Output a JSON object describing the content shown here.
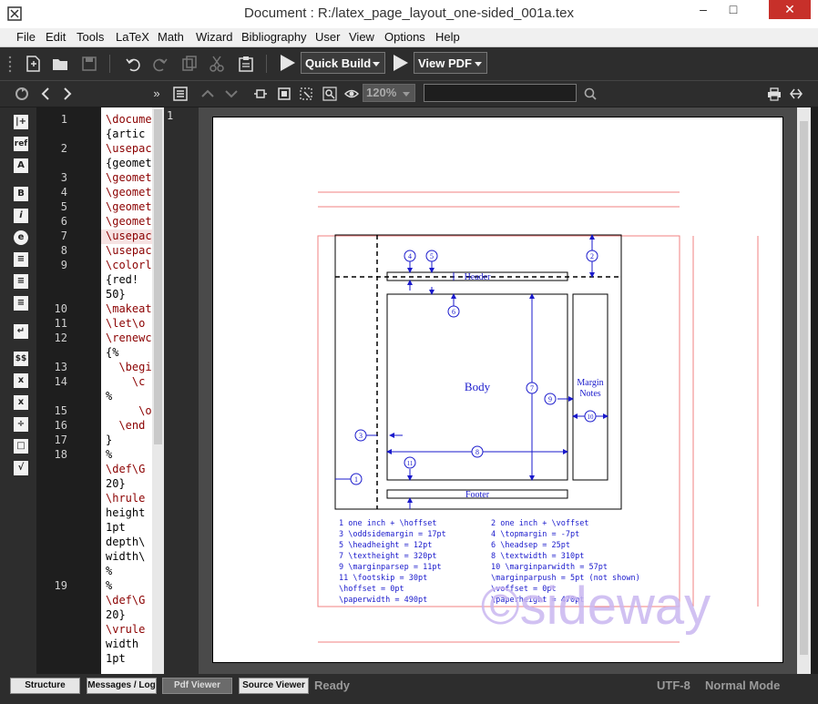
{
  "window": {
    "title": "Document : R:/latex_page_layout_one-sided_001a.tex",
    "minimize": "–",
    "maximize": "□",
    "close": "✕"
  },
  "menu": [
    "File",
    "Edit",
    "Tools",
    "LaTeX",
    "Math",
    "Wizard",
    "Bibliography",
    "User",
    "View",
    "Options",
    "Help"
  ],
  "toolbar": {
    "build_label": "Quick Build",
    "view_label": "View PDF"
  },
  "pdf_toolbar": {
    "zoom": "120%",
    "search_value": ""
  },
  "left_sidebar_icons": [
    "|+",
    "ref",
    "A",
    "B",
    "i",
    "e",
    "≡",
    "≡",
    "≡",
    "↵",
    "$$",
    "x",
    "x",
    "÷",
    "□",
    "√"
  ],
  "editor": {
    "lines": [
      {
        "num": "1",
        "text": "\\docume"
      },
      {
        "num": "",
        "text": "{artic"
      },
      {
        "num": "2",
        "text": "\\usepac"
      },
      {
        "num": "",
        "text": "{geomet"
      },
      {
        "num": "3",
        "text": "\\geomet"
      },
      {
        "num": "4",
        "text": "\\geomet"
      },
      {
        "num": "5",
        "text": "\\geomet"
      },
      {
        "num": "6",
        "text": "\\geomet"
      },
      {
        "num": "7",
        "text": "\\usepac"
      },
      {
        "num": "8",
        "text": "\\usepac"
      },
      {
        "num": "9",
        "text": "\\colorl"
      },
      {
        "num": "",
        "text": "{red!"
      },
      {
        "num": "",
        "text": "50}"
      },
      {
        "num": "10",
        "text": "\\makeat"
      },
      {
        "num": "11",
        "text": "\\let\\o"
      },
      {
        "num": "12",
        "text": "\\renewc"
      },
      {
        "num": "",
        "text": "{%"
      },
      {
        "num": "13",
        "text": "  \\begi"
      },
      {
        "num": "14",
        "text": "    \\c"
      },
      {
        "num": "",
        "text": "%"
      },
      {
        "num": "15",
        "text": "     \\o"
      },
      {
        "num": "16",
        "text": "  \\end"
      },
      {
        "num": "17",
        "text": "}"
      },
      {
        "num": "18",
        "text": "%"
      },
      {
        "num": "",
        "text": "\\def\\G"
      },
      {
        "num": "",
        "text": "20}"
      },
      {
        "num": "",
        "text": "\\hrule"
      },
      {
        "num": "",
        "text": "height"
      },
      {
        "num": "",
        "text": "1pt"
      },
      {
        "num": "",
        "text": "depth\\"
      },
      {
        "num": "",
        "text": "width\\"
      },
      {
        "num": "",
        "text": "%"
      },
      {
        "num": "19",
        "text": "%"
      },
      {
        "num": "",
        "text": "\\def\\G"
      },
      {
        "num": "",
        "text": "20}"
      },
      {
        "num": "",
        "text": "\\vrule"
      },
      {
        "num": "",
        "text": "width"
      },
      {
        "num": "",
        "text": "1pt"
      }
    ]
  },
  "pdf": {
    "page_number": "1",
    "labels": {
      "header": "Header",
      "body": "Body",
      "margin_notes_1": "Margin",
      "margin_notes_2": "Notes",
      "footer": "Footer"
    },
    "callouts": [
      "1",
      "2",
      "3",
      "4",
      "5",
      "6",
      "7",
      "8",
      "9",
      "10",
      "11"
    ],
    "legend_left": [
      "1   one inch + \\hoffset",
      "3   \\oddsidemargin = 17pt",
      "5   \\headheight = 12pt",
      "7   \\textheight = 320pt",
      "9   \\marginparsep = 11pt",
      "11  \\footskip = 30pt",
      "    \\hoffset = 0pt",
      "    \\paperwidth = 490pt"
    ],
    "legend_right": [
      "2   one inch + \\voffset",
      "4   \\topmargin = -7pt",
      "6   \\headsep = 25pt",
      "8   \\textwidth = 310pt",
      "10  \\marginparwidth = 57pt",
      "    \\marginparpush = 5pt (not shown)",
      "    \\voffset = 0pt",
      "    \\paperheight = 470pt"
    ],
    "watermark": "©sideway"
  },
  "statusbar": {
    "buttons": [
      "Structure",
      "Messages / Log",
      "Pdf Viewer",
      "Source Viewer"
    ],
    "status": "Ready",
    "encoding": "UTF-8",
    "mode": "Normal Mode"
  },
  "colors": {
    "accent": "#2d2d2d",
    "close": "#c7302a",
    "diagram_blue": "#1a1acc",
    "guide_red": "#f08080"
  }
}
